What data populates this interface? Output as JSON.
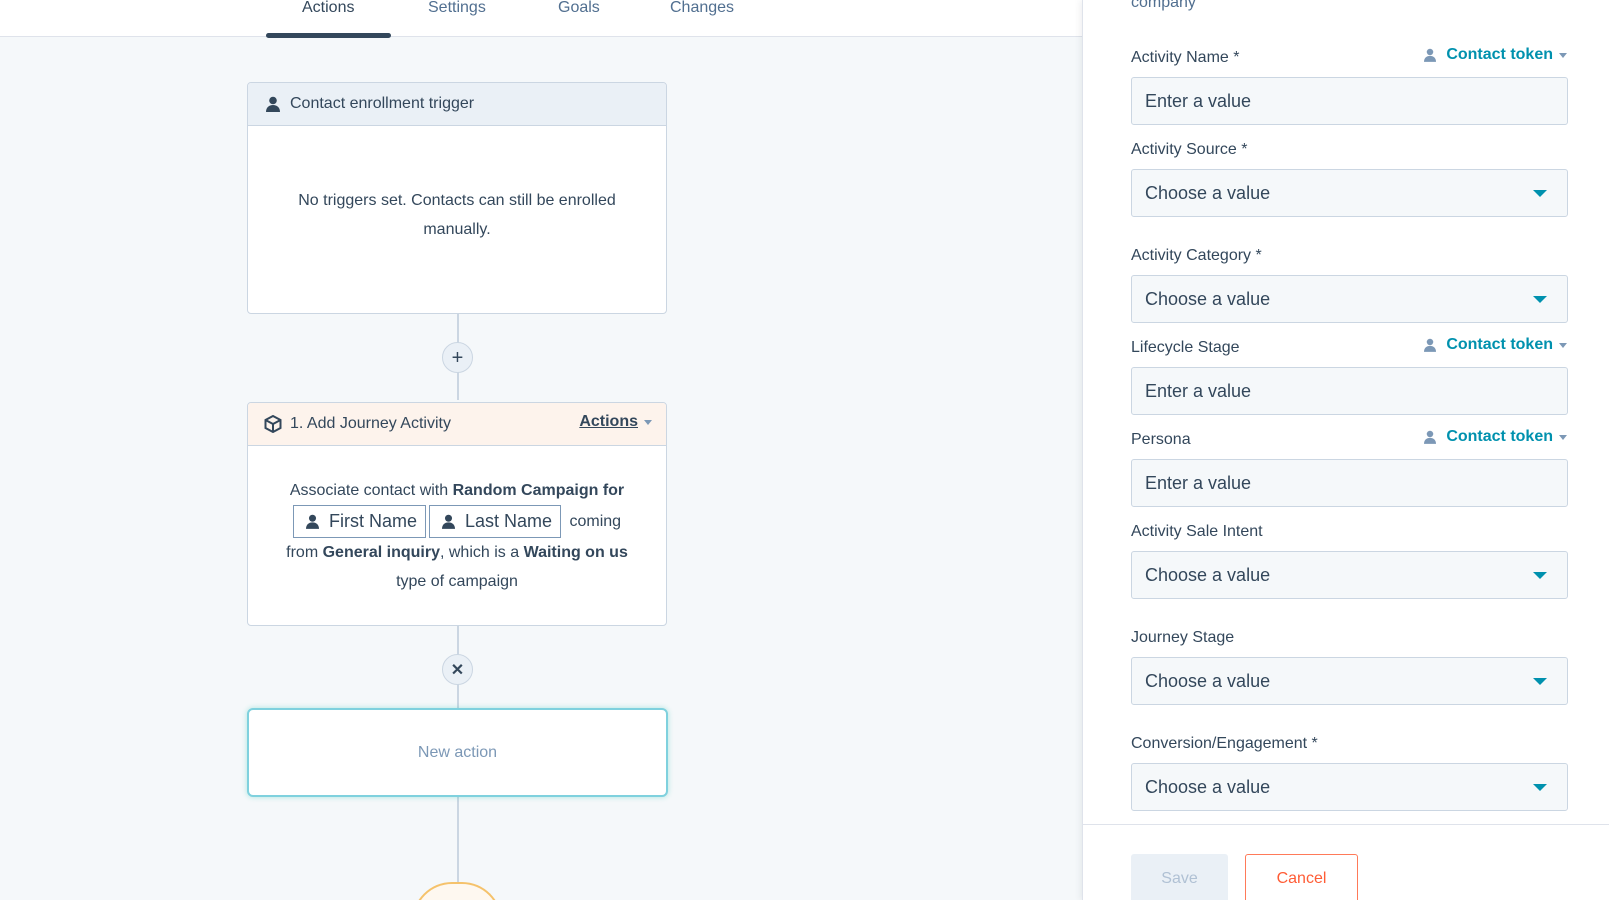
{
  "tabs": [
    {
      "label": "Actions",
      "active": true
    },
    {
      "label": "Settings",
      "active": false
    },
    {
      "label": "Goals",
      "active": false
    },
    {
      "label": "Changes",
      "active": false
    }
  ],
  "trigger_card": {
    "title": "Contact enrollment trigger",
    "icon": "person-icon",
    "message_line1": "No triggers set. Contacts can still be enrolled",
    "message_line2": "manually."
  },
  "add_button": {
    "symbol": "+"
  },
  "action_card": {
    "title": "1. Add Journey Activity",
    "icon": "cube-icon",
    "actions_label": "Actions",
    "text_associate": "Associate contact with ",
    "campaign": "Random Campaign for",
    "token_first": "First Name",
    "token_last": "Last Name",
    "text_coming": "coming",
    "text_from": "from ",
    "source": "General inquiry",
    "text_which": ", which is a ",
    "campaign_type": "Waiting on us",
    "text_type": "type of campaign"
  },
  "remove_button": {
    "symbol": "✕"
  },
  "new_action": {
    "label": "New action"
  },
  "panel": {
    "top_text": "company",
    "contact_token_label": "Contact token",
    "fields": [
      {
        "label": "Activity Name *",
        "value": "Enter a value",
        "kind": "text",
        "token": true
      },
      {
        "label": "Activity Source *",
        "value": "Choose a value",
        "kind": "select",
        "token": false
      },
      {
        "label": "Activity Category *",
        "value": "Choose a value",
        "kind": "select",
        "token": false
      },
      {
        "label": "Lifecycle Stage",
        "value": "Enter a value",
        "kind": "text",
        "token": true
      },
      {
        "label": "Persona",
        "value": "Enter a value",
        "kind": "text",
        "token": true
      },
      {
        "label": "Activity Sale Intent",
        "value": "Choose a value",
        "kind": "select",
        "token": false
      },
      {
        "label": "Journey Stage",
        "value": "Choose a value",
        "kind": "select",
        "token": false
      },
      {
        "label": "Conversion/Engagement *",
        "value": "Choose a value",
        "kind": "select",
        "token": false
      }
    ],
    "save_label": "Save",
    "cancel_label": "Cancel"
  },
  "colors": {
    "accent": "#0091ae",
    "cancel": "#ff5c35",
    "selected_border": "#7fd1de"
  }
}
